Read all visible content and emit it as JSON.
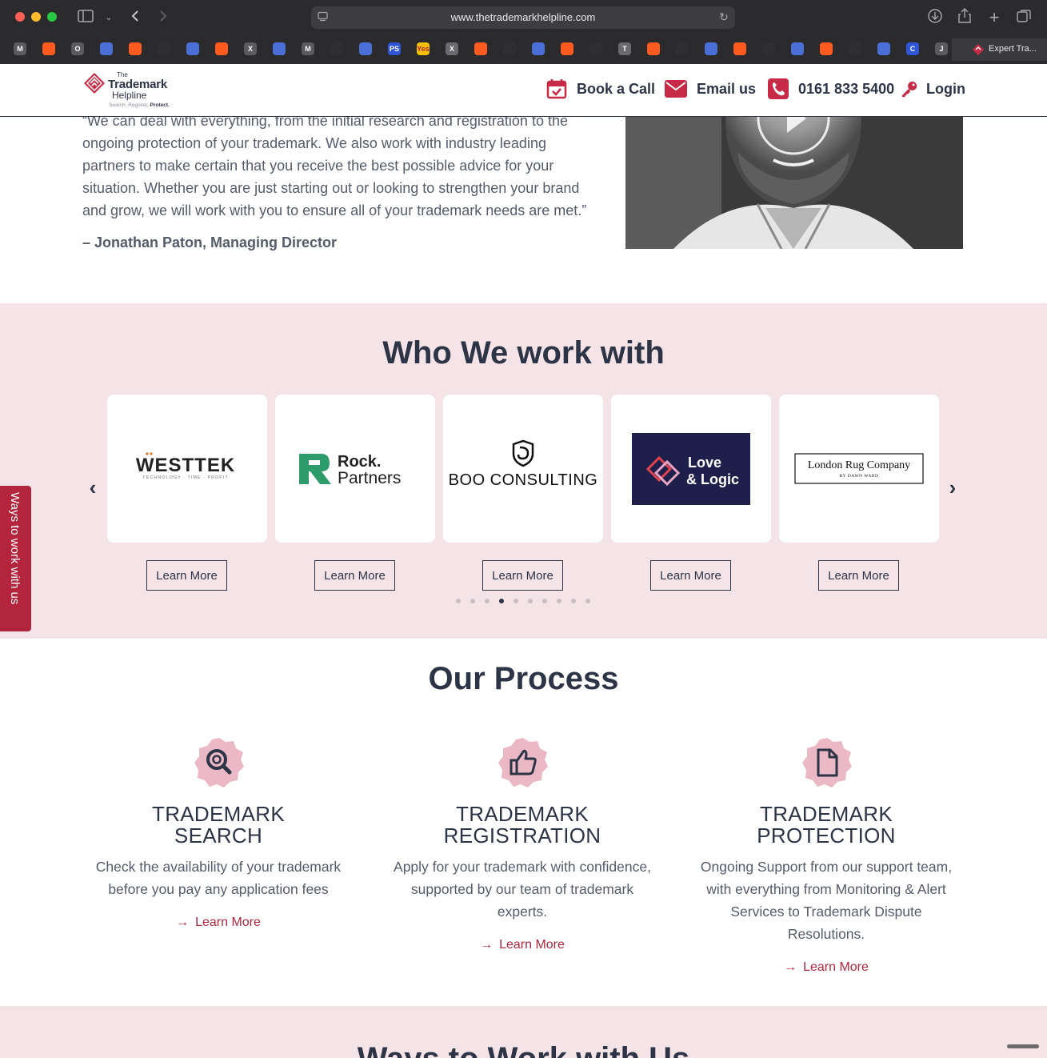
{
  "browser": {
    "url": "www.thetrademarkhelpline.com",
    "active_tab_title": "Expert Tra...",
    "favicons": [
      "M",
      "",
      "O",
      "",
      "",
      "",
      "",
      "",
      "X",
      "",
      "M",
      "",
      "",
      "PS",
      "Yes",
      "X",
      "",
      "",
      "",
      "",
      "",
      "T",
      "",
      "",
      "",
      "",
      "",
      "",
      "",
      "",
      "",
      "C",
      "J"
    ]
  },
  "header": {
    "logo": {
      "the": "The",
      "trademark": "Trademark",
      "helpline": "Helpline",
      "tagline_a": "Search. Register. ",
      "tagline_b": "Protect."
    },
    "nav": {
      "book": "Book a Call",
      "email": "Email us",
      "phone": "0161 833 5400",
      "login": "Login"
    }
  },
  "quote": {
    "text": "“We can deal with everything, from the initial research and registration to the ongoing protection of your trademark. We also work with industry leading partners to make certain that you receive the best possible advice for your situation. Whether you are just starting out or looking to strengthen your brand and grow, we will work with you to ensure all of your trademark needs are met.”",
    "author": "– Jonathan Paton, Managing Director"
  },
  "partners": {
    "title": "Who We work with",
    "cards": [
      {
        "name": "WESTTEK",
        "sub": "TECHNOLOGY · TIME · PROFIT",
        "button": "Learn More"
      },
      {
        "name_a": "Rock.",
        "name_b": "Partners",
        "button": "Learn More"
      },
      {
        "name": "BOO CONSULTING",
        "button": "Learn More"
      },
      {
        "name_a": "Love",
        "name_b": "& Logic",
        "button": "Learn More"
      },
      {
        "name": "London Rug Company",
        "sub": "BY DAWN WARD",
        "button": "Learn More"
      }
    ],
    "dots_total": 10,
    "active_dot": 4
  },
  "sidetab": {
    "label": "Ways to work with us"
  },
  "process": {
    "title": "Our Process",
    "steps": [
      {
        "title_1": "TRADEMARK",
        "title_2": "SEARCH",
        "text": "Check the availability of your trademark before you pay any application fees",
        "link": "Learn More",
        "icon": "magnifier-icon"
      },
      {
        "title_1": "TRADEMARK",
        "title_2": "REGISTRATION",
        "text": "Apply for your trademark with confidence, supported by our team of trademark experts.",
        "link": "Learn More",
        "icon": "thumbs-up-icon"
      },
      {
        "title_1": "TRADEMARK",
        "title_2": "PROTECTION",
        "text": "Ongoing Support from our support team, with everything from Monitoring & Alert Services to Trademark Dispute Resolutions.",
        "link": "Learn More",
        "icon": "document-icon"
      }
    ]
  },
  "bottom": {
    "title": "Ways to Work with Us"
  },
  "colors": {
    "brand_red": "#b3243d",
    "navy": "#2d3446",
    "pink_band": "#f5e4e7",
    "badge_pink": "#ebb8c6"
  }
}
